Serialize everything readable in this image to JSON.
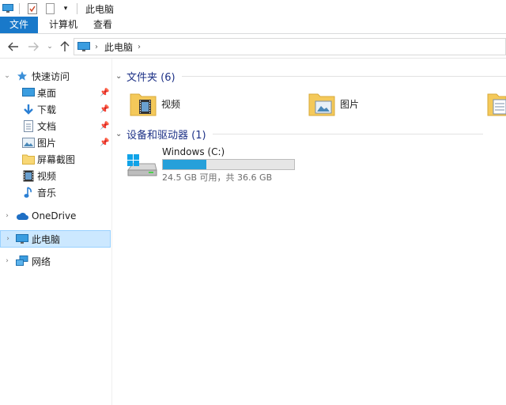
{
  "window": {
    "title": "此电脑"
  },
  "ribbon": {
    "tabs": [
      "文件",
      "计算机",
      "查看"
    ]
  },
  "address": {
    "crumbs": [
      "此电脑"
    ]
  },
  "nav": {
    "quick_access": "快速访问",
    "items": [
      {
        "label": "桌面",
        "icon": "desktop-icon"
      },
      {
        "label": "下载",
        "icon": "download-icon"
      },
      {
        "label": "文档",
        "icon": "document-icon"
      },
      {
        "label": "图片",
        "icon": "pictures-icon"
      },
      {
        "label": "屏幕截图",
        "icon": "folder-icon"
      },
      {
        "label": "视频",
        "icon": "video-icon"
      },
      {
        "label": "音乐",
        "icon": "music-icon"
      }
    ],
    "onedrive": "OneDrive",
    "this_pc": "此电脑",
    "network": "网络"
  },
  "content": {
    "folders_header": "文件夹 (6)",
    "folders": [
      {
        "name": "视频",
        "icon": "video-folder-icon"
      },
      {
        "name": "图片",
        "icon": "pictures-folder-icon"
      }
    ],
    "devices_header": "设备和驱动器 (1)",
    "drive": {
      "name": "Windows (C:)",
      "free_text": "24.5 GB 可用，共 36.6 GB",
      "used_fraction": 0.33
    }
  },
  "colors": {
    "accent": "#1979ca",
    "selection": "#cce8ff",
    "bar_fill": "#26a0da"
  }
}
